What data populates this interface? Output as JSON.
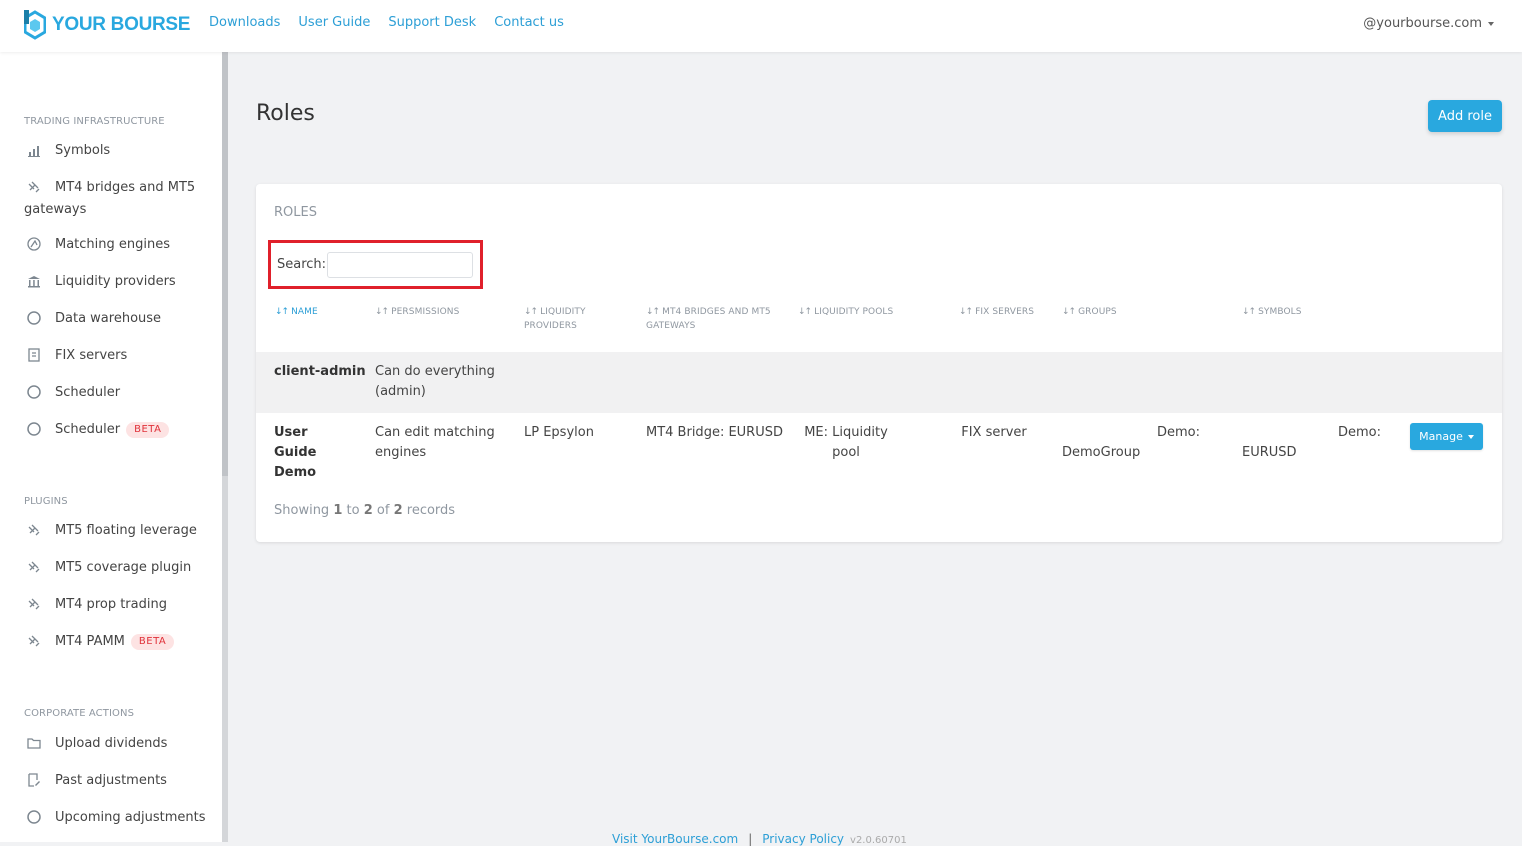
{
  "brand": {
    "name": "YOUR BOURSE"
  },
  "topnav": {
    "links": [
      "Downloads",
      "User Guide",
      "Support Desk",
      "Contact us"
    ],
    "user": "@yourbourse.com"
  },
  "sidebar": {
    "sections": [
      {
        "title": "TRADING INFRASTRUCTURE",
        "items": [
          {
            "label": "Symbols",
            "icon": "bar-chart-icon"
          },
          {
            "label": "MT4 bridges and MT5 gateways",
            "icon": "bridge-icon"
          },
          {
            "label": "Matching engines",
            "icon": "engine-icon"
          },
          {
            "label": "Liquidity providers",
            "icon": "bank-icon"
          },
          {
            "label": "Data warehouse",
            "icon": "circle-icon"
          },
          {
            "label": "FIX servers",
            "icon": "document-icon"
          },
          {
            "label": "Scheduler",
            "icon": "circle-icon"
          },
          {
            "label": "Scheduler",
            "icon": "circle-icon",
            "badge": "BETA"
          }
        ]
      },
      {
        "title": "PLUGINS",
        "items": [
          {
            "label": "MT5 floating leverage",
            "icon": "bridge-icon"
          },
          {
            "label": "MT5 coverage plugin",
            "icon": "bridge-icon"
          },
          {
            "label": "MT4 prop trading",
            "icon": "bridge-icon"
          },
          {
            "label": "MT4 PAMM",
            "icon": "bridge-icon",
            "badge": "BETA"
          }
        ]
      },
      {
        "title": "CORPORATE ACTIONS",
        "items": [
          {
            "label": "Upload dividends",
            "icon": "folder-icon"
          },
          {
            "label": "Past adjustments",
            "icon": "edit-doc-icon"
          },
          {
            "label": "Upcoming adjustments",
            "icon": "circle-icon"
          }
        ]
      }
    ]
  },
  "main": {
    "title": "Roles",
    "add_button": "Add role",
    "card_title": "ROLES",
    "search_label": "Search:",
    "search_value": "",
    "columns": [
      "NAME",
      "PERSMISSIONS",
      "LIQUIDITY PROVIDERS",
      "MT4 BRIDGES AND MT5 GATEWAYS",
      "LIQUIDITY POOLS",
      "FIX SERVERS",
      "GROUPS",
      "SYMBOLS"
    ],
    "rows": [
      {
        "name": "client-admin",
        "permissions": "Can do everything (admin)",
        "liquidity_providers": "",
        "bridges": "",
        "pools": "",
        "fix": "",
        "groups": "",
        "symbols": ""
      },
      {
        "name": "User Guide Demo",
        "permissions": "Can edit matching engines",
        "liquidity_providers": "LP Epsylon",
        "bridges": "MT4 Bridge: EURUSD",
        "pools": "ME: Liquidity pool",
        "fix": "FIX server",
        "groups": "DemoGroup",
        "groups_prefix": "Demo:",
        "symbols": "EURUSD",
        "symbols_prefix": "Demo:",
        "action": "Manage"
      }
    ],
    "showing": {
      "prefix": "Showing",
      "from": "1",
      "to_word": "to",
      "to": "2",
      "of_word": "of",
      "total": "2",
      "suffix": "records"
    }
  },
  "footer": {
    "link1": "Visit YourBourse.com",
    "sep": "|",
    "link2": "Privacy Policy",
    "version": "v2.0.60701"
  },
  "colors": {
    "accent": "#29a8df",
    "beta_bg": "#fde3e3",
    "beta_text": "#e0323a",
    "highlight": "#e0202b"
  }
}
